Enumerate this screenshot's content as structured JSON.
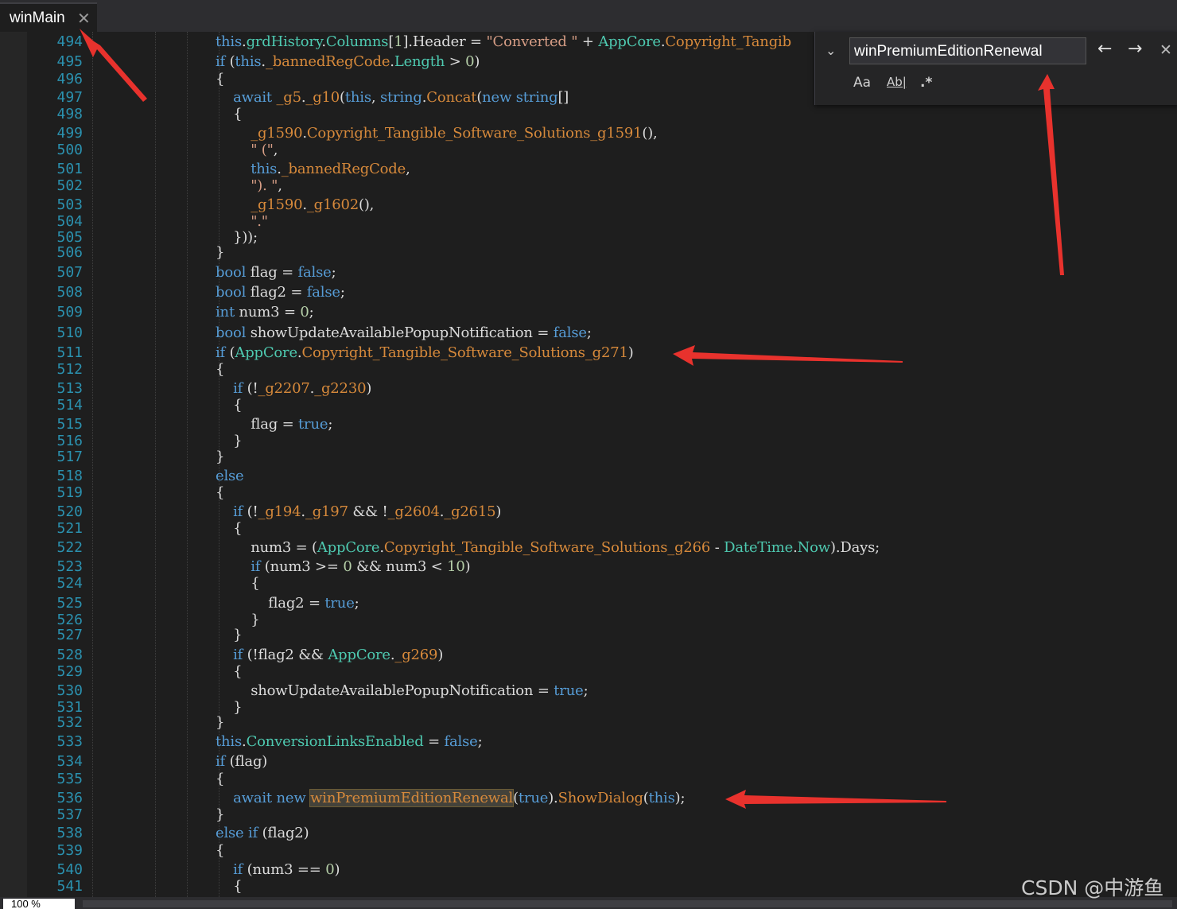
{
  "tab": {
    "title": "winMain",
    "close_glyph": "✕"
  },
  "find": {
    "query": "winPremiumEditionRenewal",
    "expand_icon": "chevron-down-icon",
    "prev_label": "←",
    "next_label": "→",
    "close_label": "✕",
    "match_case_label": "Aa",
    "whole_word_label": "Ab|",
    "regex_label": ".*"
  },
  "status": {
    "zoom": "100 %"
  },
  "watermark": "CSDN @中游鱼",
  "colors": {
    "background": "#1e1e1e",
    "keyword": "#569cd6",
    "type": "#4ec9b0",
    "field": "#d6893b",
    "line_number": "#2b91af",
    "annotation_arrow": "#e8322d"
  },
  "line_numbers": [
    "494",
    "495",
    "496",
    "497",
    "498",
    "499",
    "500",
    "501",
    "502",
    "503",
    "504",
    "505",
    "506",
    "507",
    "508",
    "509",
    "510",
    "511",
    "512",
    "513",
    "514",
    "515",
    "516",
    "517",
    "518",
    "519",
    "520",
    "521",
    "522",
    "523",
    "524",
    "525",
    "526",
    "527",
    "528",
    "529",
    "530",
    "531",
    "532",
    "533",
    "534",
    "535",
    "536",
    "537",
    "538",
    "539",
    "540",
    "541"
  ],
  "code": [
    "this.grdHistory.Columns[1].Header = \"Converted \" + AppCore.Copyright_Tangib",
    "if (this._bannedRegCode.Length > 0)",
    "{",
    "    await _g5._g10(this, string.Concat(new string[]",
    "    {",
    "        _g1590.Copyright_Tangible_Software_Solutions_g1591(),",
    "        \" (\",",
    "        this._bannedRegCode,",
    "        \"). \",",
    "        _g1590._g1602(),",
    "        \".\"",
    "    }));",
    "}",
    "bool flag = false;",
    "bool flag2 = false;",
    "int num3 = 0;",
    "bool showUpdateAvailablePopupNotification = false;",
    "if (AppCore.Copyright_Tangible_Software_Solutions_g271)",
    "{",
    "    if (!_g2207._g2230)",
    "    {",
    "        flag = true;",
    "    }",
    "}",
    "else",
    "{",
    "    if (!_g194._g197 && !_g2604._g2615)",
    "    {",
    "        num3 = (AppCore.Copyright_Tangible_Software_Solutions_g266 - DateTime.Now).Days;",
    "        if (num3 >= 0 && num3 < 10)",
    "        {",
    "            flag2 = true;",
    "        }",
    "    }",
    "    if (!flag2 && AppCore._g269)",
    "    {",
    "        showUpdateAvailablePopupNotification = true;",
    "    }",
    "}",
    "this.ConversionLinksEnabled = false;",
    "if (flag)",
    "{",
    "    await new winPremiumEditionRenewal(true).ShowDialog(this);",
    "}",
    "else if (flag2)",
    "{",
    "    if (num3 == 0)",
    "    {"
  ]
}
